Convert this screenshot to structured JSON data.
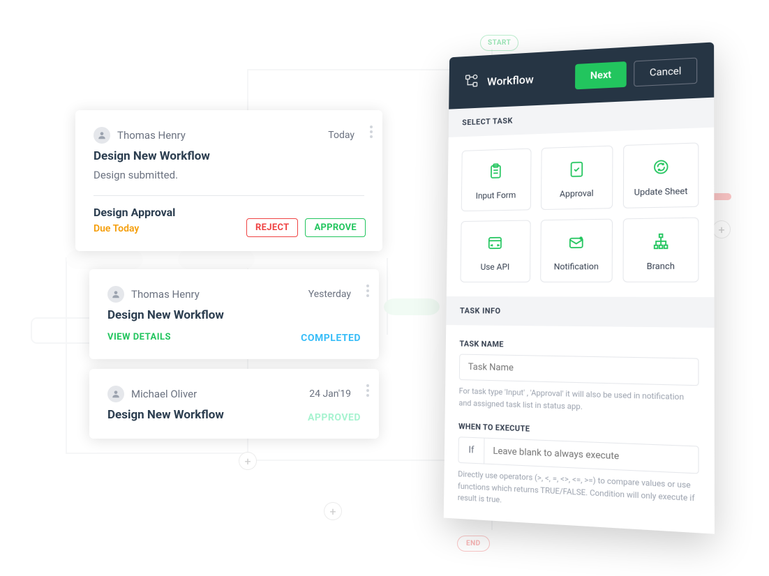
{
  "cards": [
    {
      "author": "Thomas Henry",
      "date": "Today",
      "title": "Design New Workflow",
      "subtitle": "Design submitted.",
      "section": "Design Approval",
      "due": "Due Today",
      "reject": "REJECT",
      "approve": "APPROVE"
    },
    {
      "author": "Thomas Henry",
      "date": "Yesterday",
      "title": "Design New Workflow",
      "status": "COMPLETED",
      "view": "VIEW DETAILS"
    },
    {
      "author": "Michael Oliver",
      "date": "24 Jan'19",
      "title": "Design New Workflow",
      "status": "APPROVED"
    }
  ],
  "panel": {
    "title": "Workflow",
    "next": "Next",
    "cancel": "Cancel",
    "selectTask": "SELECT TASK",
    "tiles": [
      {
        "label": "Input Form",
        "icon": "clipboard"
      },
      {
        "label": "Approval",
        "icon": "check-shield"
      },
      {
        "label": "Update Sheet",
        "icon": "refresh-doc"
      },
      {
        "label": "Use API",
        "icon": "api"
      },
      {
        "label": "Notification",
        "icon": "mail"
      },
      {
        "label": "Branch",
        "icon": "branch"
      }
    ],
    "taskInfo": "TASK INFO",
    "taskNameLabel": "TASK NAME",
    "taskNamePlaceholder": "Task Name",
    "taskNameHelper": "For task type 'Input' , 'Approval' it will also be used in notification and assigned task list in status app.",
    "whenLabel": "WHEN TO EXECUTE",
    "ifLabel": "If",
    "whenPlaceholder": "Leave blank to always execute",
    "whenHelper": "Directly use operators (>, <, =, <>, <=, >=) to compare values or use functions which returns TRUE/FALSE. Condition will only execute if result is true."
  },
  "badges": {
    "start": "START",
    "end": "END"
  }
}
